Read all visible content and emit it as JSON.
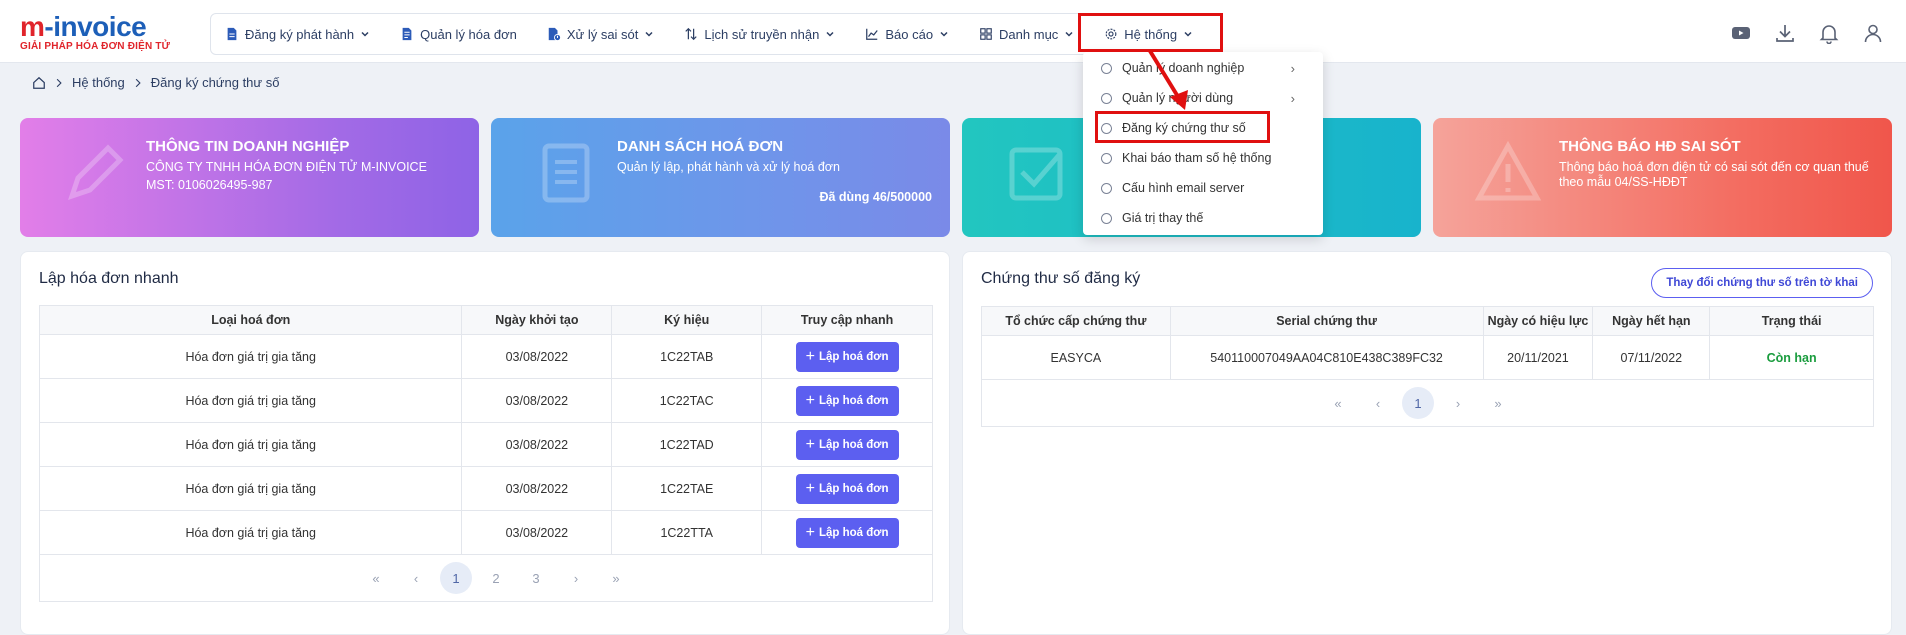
{
  "logo": {
    "brand_m": "m",
    "brand_rest": "-invoice",
    "tagline": "GIẢI PHÁP HÓA ĐƠN ĐIỆN TỬ"
  },
  "nav": [
    {
      "label": "Đăng ký phát hành",
      "icon": "doc-icon",
      "dropdown": true
    },
    {
      "label": "Quản lý hóa đơn",
      "icon": "file-icon",
      "dropdown": false
    },
    {
      "label": "Xử lý sai sót",
      "icon": "file-alert-icon",
      "dropdown": true
    },
    {
      "label": "Lịch sử truyền nhận",
      "icon": "arrows-updown-icon",
      "dropdown": true
    },
    {
      "label": "Báo cáo",
      "icon": "chart-icon",
      "dropdown": true
    },
    {
      "label": "Danh mục",
      "icon": "grid-icon",
      "dropdown": true
    },
    {
      "label": "Hệ thống",
      "icon": "gear-icon",
      "dropdown": true
    }
  ],
  "breadcrumb": [
    "Hệ thống",
    "Đăng ký chứng thư số"
  ],
  "cards": [
    {
      "title": "THÔNG TIN DOANH NGHIỆP",
      "lines": [
        "CÔNG TY TNHH HÓA ĐƠN ĐIỆN TỬ M-INVOICE",
        "MST: 0106026495-987"
      ]
    },
    {
      "title": "DANH SÁCH HOÁ ĐƠN",
      "lines": [
        "Quản lý lập, phát hành và xử lý hoá đơn"
      ],
      "used": "Đã dùng 46/500000"
    },
    {
      "title": "",
      "lines": []
    },
    {
      "title": "THÔNG BÁO HĐ SAI SÓT",
      "lines": [
        "Thông báo hoá đơn điện tử có sai sót đến cơ quan thuế",
        "theo mẫu 04/SS-HĐĐT"
      ]
    }
  ],
  "quick_invoice": {
    "title": "Lập hóa đơn nhanh",
    "headers": [
      "Loại hoá đơn",
      "Ngày khởi tạo",
      "Ký hiệu",
      "Truy cập nhanh"
    ],
    "rows": [
      [
        "Hóa đơn giá trị gia tăng",
        "03/08/2022",
        "1C22TAB",
        "Lập hoá đơn"
      ],
      [
        "Hóa đơn giá trị gia tăng",
        "03/08/2022",
        "1C22TAC",
        "Lập hoá đơn"
      ],
      [
        "Hóa đơn giá trị gia tăng",
        "03/08/2022",
        "1C22TAD",
        "Lập hoá đơn"
      ],
      [
        "Hóa đơn giá trị gia tăng",
        "03/08/2022",
        "1C22TAE",
        "Lập hoá đơn"
      ],
      [
        "Hóa đơn giá trị gia tăng",
        "03/08/2022",
        "1C22TTA",
        "Lập hoá đơn"
      ]
    ],
    "pager": [
      "«",
      "‹",
      "1",
      "2",
      "3",
      "›",
      "»"
    ],
    "current_page": "1"
  },
  "certificates": {
    "title": "Chứng thư số đăng ký",
    "change_button": "Thay đổi chứng thư số trên tờ khai",
    "headers": [
      "Tổ chức cấp chứng thư",
      "Serial chứng thư",
      "Ngày có hiệu lực",
      "Ngày hết hạn",
      "Trạng thái"
    ],
    "rows": [
      [
        "EASYCA",
        "540110007049AA04C810E438C389FC32",
        "20/11/2021",
        "07/11/2022",
        "Còn hạn"
      ]
    ],
    "pager": [
      "«",
      "‹",
      "1",
      "›",
      "»"
    ],
    "current_page": "1"
  },
  "dropdown": {
    "items": [
      {
        "label": "Quản lý doanh nghiệp",
        "submenu": true
      },
      {
        "label": "Quản lý người dùng",
        "submenu": true
      },
      {
        "label": "Đăng ký chứng thư số",
        "submenu": false
      },
      {
        "label": "Khai báo tham số hệ thống",
        "submenu": false
      },
      {
        "label": "Cấu hình email server",
        "submenu": false
      },
      {
        "label": "Giá trị thay thế",
        "submenu": false
      }
    ]
  },
  "colors": {
    "primary": "#5c5ff0",
    "highlight": "#e01010",
    "status_ok": "#1a9c3e",
    "brand_red": "#e0242b",
    "brand_blue": "#1d5fb8"
  }
}
